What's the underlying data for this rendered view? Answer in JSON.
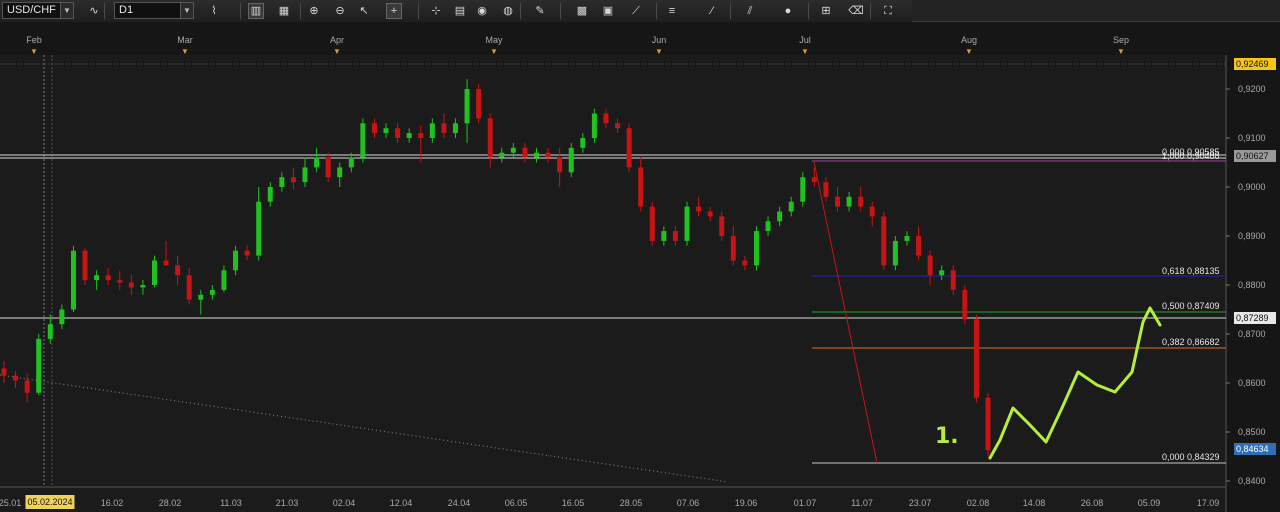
{
  "toolbar": {
    "symbol": "USD/CHF",
    "timeframe": "D1",
    "buttons": [
      {
        "name": "indicator-icon",
        "glyph": "∿"
      },
      {
        "name": "line-chart-icon",
        "glyph": "⌇"
      },
      {
        "name": "bar-chart-icon",
        "glyph": "▥"
      },
      {
        "name": "candle-chart-icon",
        "glyph": "▦"
      },
      {
        "name": "zoom-in-icon",
        "glyph": "⊕"
      },
      {
        "name": "zoom-out-icon",
        "glyph": "⊖"
      },
      {
        "name": "cursor-icon",
        "glyph": "↖"
      },
      {
        "name": "crosshair-icon",
        "glyph": "+"
      },
      {
        "name": "cursor-mode-icon",
        "glyph": "⊹"
      },
      {
        "name": "note-icon",
        "glyph": "▤"
      },
      {
        "name": "eye-icon",
        "glyph": "◉"
      },
      {
        "name": "globe-icon",
        "glyph": "◍"
      },
      {
        "name": "pencil-icon",
        "glyph": "✎"
      },
      {
        "name": "image-icon",
        "glyph": "▩"
      },
      {
        "name": "screenshot-icon",
        "glyph": "▣"
      },
      {
        "name": "fan-icon",
        "glyph": "⟋"
      },
      {
        "name": "fibonacci-icon",
        "glyph": "≡"
      },
      {
        "name": "line-tool-icon",
        "glyph": "∕"
      },
      {
        "name": "channel-icon",
        "glyph": "⫽"
      },
      {
        "name": "shape-icon",
        "glyph": "●"
      },
      {
        "name": "template-icon",
        "glyph": "⊞"
      },
      {
        "name": "eraser-icon",
        "glyph": "⌫"
      },
      {
        "name": "objects-icon",
        "glyph": "⛶"
      }
    ]
  },
  "months": [
    "Feb",
    "Mar",
    "Apr",
    "May",
    "Jun",
    "Jul",
    "Aug",
    "Sep"
  ],
  "dates": [
    "25.01",
    "16.02",
    "28.02",
    "11.03",
    "21.03",
    "02.04",
    "12.04",
    "24.04",
    "06.05",
    "16.05",
    "28.05",
    "07.06",
    "19.06",
    "01.07",
    "11.07",
    "23.07",
    "02.08",
    "14.08",
    "26.08",
    "05.09",
    "17.09"
  ],
  "highlighted_date": "05.02.2024",
  "price_axis": [
    "0,9200",
    "0,9100",
    "0,9000",
    "0,8900",
    "0,8800",
    "0,8700",
    "0,8600",
    "0,8500",
    "0,8400"
  ],
  "price_boxes": {
    "top": "0,92469",
    "current": "0,90627",
    "level": "0,87289",
    "bottom": "0,84634"
  },
  "fib_labels": [
    "0,000 0,90585",
    "1,000 0,90488",
    "0,618 0,88135",
    "0,500 0,87409",
    "0,382 0,86682",
    "0,000 0,84329"
  ],
  "handwritten_annotation": "1.",
  "colors": {
    "bull": "#1fc21f",
    "bear": "#c81414",
    "fib_blue": "#2020c0",
    "fib_green": "#20a020",
    "fib_orange": "#e07020",
    "fib_purple": "#a040a0",
    "annotation": "#b5ee3b"
  },
  "chart_data": {
    "type": "candlestick",
    "y_range": [
      0.84,
      0.926
    ],
    "levels": {
      "horizontal": [
        0.9062,
        0.8729
      ],
      "fib_0618": 0.88135,
      "fib_0500": 0.87409,
      "fib_0382": 0.86682,
      "fib_low": 0.84329,
      "fib_high": 0.90488
    },
    "series": [
      {
        "date": "29.01",
        "open": 0.863,
        "high": 0.8645,
        "low": 0.86,
        "close": 0.8615
      },
      {
        "date": "31.01",
        "open": 0.8615,
        "high": 0.8625,
        "low": 0.859,
        "close": 0.8605
      },
      {
        "date": "02.02",
        "open": 0.8605,
        "high": 0.862,
        "low": 0.856,
        "close": 0.858
      },
      {
        "date": "05.02",
        "open": 0.858,
        "high": 0.87,
        "low": 0.8575,
        "close": 0.869
      },
      {
        "date": "07.02",
        "open": 0.869,
        "high": 0.874,
        "low": 0.868,
        "close": 0.872
      },
      {
        "date": "09.02",
        "open": 0.872,
        "high": 0.876,
        "low": 0.871,
        "close": 0.875
      },
      {
        "date": "12.02",
        "open": 0.875,
        "high": 0.888,
        "low": 0.8745,
        "close": 0.887
      },
      {
        "date": "14.02",
        "open": 0.887,
        "high": 0.8875,
        "low": 0.88,
        "close": 0.881
      },
      {
        "date": "16.02",
        "open": 0.881,
        "high": 0.883,
        "low": 0.879,
        "close": 0.882
      },
      {
        "date": "19.02",
        "open": 0.882,
        "high": 0.8835,
        "low": 0.88,
        "close": 0.881
      },
      {
        "date": "21.02",
        "open": 0.881,
        "high": 0.883,
        "low": 0.879,
        "close": 0.8805
      },
      {
        "date": "23.02",
        "open": 0.8805,
        "high": 0.882,
        "low": 0.878,
        "close": 0.8795
      },
      {
        "date": "26.02",
        "open": 0.8795,
        "high": 0.881,
        "low": 0.878,
        "close": 0.88
      },
      {
        "date": "28.02",
        "open": 0.88,
        "high": 0.886,
        "low": 0.8795,
        "close": 0.885
      },
      {
        "date": "01.03",
        "open": 0.885,
        "high": 0.889,
        "low": 0.884,
        "close": 0.884
      },
      {
        "date": "04.03",
        "open": 0.884,
        "high": 0.886,
        "low": 0.88,
        "close": 0.882
      },
      {
        "date": "06.03",
        "open": 0.882,
        "high": 0.8835,
        "low": 0.876,
        "close": 0.877
      },
      {
        "date": "08.03",
        "open": 0.877,
        "high": 0.879,
        "low": 0.874,
        "close": 0.878
      },
      {
        "date": "11.03",
        "open": 0.878,
        "high": 0.88,
        "low": 0.877,
        "close": 0.879
      },
      {
        "date": "13.03",
        "open": 0.879,
        "high": 0.884,
        "low": 0.8785,
        "close": 0.883
      },
      {
        "date": "15.03",
        "open": 0.883,
        "high": 0.888,
        "low": 0.882,
        "close": 0.887
      },
      {
        "date": "18.03",
        "open": 0.887,
        "high": 0.888,
        "low": 0.885,
        "close": 0.886
      },
      {
        "date": "20.03",
        "open": 0.886,
        "high": 0.9,
        "low": 0.885,
        "close": 0.897
      },
      {
        "date": "22.03",
        "open": 0.897,
        "high": 0.901,
        "low": 0.896,
        "close": 0.9
      },
      {
        "date": "25.03",
        "open": 0.9,
        "high": 0.903,
        "low": 0.899,
        "close": 0.902
      },
      {
        "date": "27.03",
        "open": 0.902,
        "high": 0.904,
        "low": 0.8995,
        "close": 0.901
      },
      {
        "date": "29.03",
        "open": 0.901,
        "high": 0.906,
        "low": 0.9,
        "close": 0.904
      },
      {
        "date": "01.04",
        "open": 0.904,
        "high": 0.908,
        "low": 0.903,
        "close": 0.906
      },
      {
        "date": "03.04",
        "open": 0.906,
        "high": 0.907,
        "low": 0.901,
        "close": 0.902
      },
      {
        "date": "05.04",
        "open": 0.902,
        "high": 0.905,
        "low": 0.9,
        "close": 0.904
      },
      {
        "date": "08.04",
        "open": 0.904,
        "high": 0.907,
        "low": 0.903,
        "close": 0.906
      },
      {
        "date": "10.04",
        "open": 0.906,
        "high": 0.914,
        "low": 0.905,
        "close": 0.913
      },
      {
        "date": "12.04",
        "open": 0.913,
        "high": 0.914,
        "low": 0.91,
        "close": 0.911
      },
      {
        "date": "15.04",
        "open": 0.911,
        "high": 0.913,
        "low": 0.91,
        "close": 0.912
      },
      {
        "date": "17.04",
        "open": 0.912,
        "high": 0.913,
        "low": 0.909,
        "close": 0.91
      },
      {
        "date": "19.04",
        "open": 0.91,
        "high": 0.912,
        "low": 0.909,
        "close": 0.911
      },
      {
        "date": "22.04",
        "open": 0.911,
        "high": 0.9125,
        "low": 0.905,
        "close": 0.91
      },
      {
        "date": "24.04",
        "open": 0.91,
        "high": 0.914,
        "low": 0.909,
        "close": 0.913
      },
      {
        "date": "26.04",
        "open": 0.913,
        "high": 0.915,
        "low": 0.91,
        "close": 0.911
      },
      {
        "date": "29.04",
        "open": 0.911,
        "high": 0.914,
        "low": 0.91,
        "close": 0.913
      },
      {
        "date": "01.05",
        "open": 0.913,
        "high": 0.922,
        "low": 0.909,
        "close": 0.92
      },
      {
        "date": "03.05",
        "open": 0.92,
        "high": 0.921,
        "low": 0.913,
        "close": 0.914
      },
      {
        "date": "06.05",
        "open": 0.914,
        "high": 0.915,
        "low": 0.904,
        "close": 0.906
      },
      {
        "date": "08.05",
        "open": 0.906,
        "high": 0.908,
        "low": 0.905,
        "close": 0.907
      },
      {
        "date": "10.05",
        "open": 0.907,
        "high": 0.909,
        "low": 0.906,
        "close": 0.908
      },
      {
        "date": "13.05",
        "open": 0.908,
        "high": 0.909,
        "low": 0.905,
        "close": 0.906
      },
      {
        "date": "15.05",
        "open": 0.906,
        "high": 0.908,
        "low": 0.905,
        "close": 0.907
      },
      {
        "date": "17.05",
        "open": 0.907,
        "high": 0.908,
        "low": 0.905,
        "close": 0.906
      },
      {
        "date": "20.05",
        "open": 0.906,
        "high": 0.908,
        "low": 0.9,
        "close": 0.903
      },
      {
        "date": "22.05",
        "open": 0.903,
        "high": 0.909,
        "low": 0.902,
        "close": 0.908
      },
      {
        "date": "24.05",
        "open": 0.908,
        "high": 0.911,
        "low": 0.907,
        "close": 0.91
      },
      {
        "date": "27.05",
        "open": 0.91,
        "high": 0.916,
        "low": 0.909,
        "close": 0.915
      },
      {
        "date": "29.05",
        "open": 0.915,
        "high": 0.916,
        "low": 0.912,
        "close": 0.913
      },
      {
        "date": "31.05",
        "open": 0.913,
        "high": 0.914,
        "low": 0.911,
        "close": 0.912
      },
      {
        "date": "03.06",
        "open": 0.912,
        "high": 0.913,
        "low": 0.903,
        "close": 0.904
      },
      {
        "date": "05.06",
        "open": 0.904,
        "high": 0.906,
        "low": 0.895,
        "close": 0.896
      },
      {
        "date": "07.06",
        "open": 0.896,
        "high": 0.897,
        "low": 0.888,
        "close": 0.889
      },
      {
        "date": "10.06",
        "open": 0.889,
        "high": 0.892,
        "low": 0.888,
        "close": 0.891
      },
      {
        "date": "12.06",
        "open": 0.891,
        "high": 0.892,
        "low": 0.888,
        "close": 0.889
      },
      {
        "date": "14.06",
        "open": 0.889,
        "high": 0.897,
        "low": 0.888,
        "close": 0.896
      },
      {
        "date": "17.06",
        "open": 0.896,
        "high": 0.898,
        "low": 0.894,
        "close": 0.895
      },
      {
        "date": "19.06",
        "open": 0.895,
        "high": 0.896,
        "low": 0.893,
        "close": 0.894
      },
      {
        "date": "21.06",
        "open": 0.894,
        "high": 0.895,
        "low": 0.889,
        "close": 0.89
      },
      {
        "date": "24.06",
        "open": 0.89,
        "high": 0.892,
        "low": 0.884,
        "close": 0.885
      },
      {
        "date": "26.06",
        "open": 0.885,
        "high": 0.886,
        "low": 0.883,
        "close": 0.884
      },
      {
        "date": "28.06",
        "open": 0.884,
        "high": 0.892,
        "low": 0.883,
        "close": 0.891
      },
      {
        "date": "01.07",
        "open": 0.891,
        "high": 0.894,
        "low": 0.89,
        "close": 0.893
      },
      {
        "date": "03.07",
        "open": 0.893,
        "high": 0.896,
        "low": 0.892,
        "close": 0.895
      },
      {
        "date": "05.07",
        "open": 0.895,
        "high": 0.898,
        "low": 0.894,
        "close": 0.897
      },
      {
        "date": "08.07",
        "open": 0.897,
        "high": 0.903,
        "low": 0.896,
        "close": 0.902
      },
      {
        "date": "10.07",
        "open": 0.902,
        "high": 0.904,
        "low": 0.9,
        "close": 0.901
      },
      {
        "date": "12.07",
        "open": 0.901,
        "high": 0.902,
        "low": 0.897,
        "close": 0.898
      },
      {
        "date": "15.07",
        "open": 0.898,
        "high": 0.9,
        "low": 0.895,
        "close": 0.896
      },
      {
        "date": "17.07",
        "open": 0.896,
        "high": 0.899,
        "low": 0.895,
        "close": 0.898
      },
      {
        "date": "19.07",
        "open": 0.898,
        "high": 0.9,
        "low": 0.895,
        "close": 0.896
      },
      {
        "date": "22.07",
        "open": 0.896,
        "high": 0.897,
        "low": 0.892,
        "close": 0.894
      },
      {
        "date": "24.07",
        "open": 0.894,
        "high": 0.895,
        "low": 0.883,
        "close": 0.884
      },
      {
        "date": "26.07",
        "open": 0.884,
        "high": 0.89,
        "low": 0.883,
        "close": 0.889
      },
      {
        "date": "29.07",
        "open": 0.889,
        "high": 0.891,
        "low": 0.888,
        "close": 0.89
      },
      {
        "date": "31.07",
        "open": 0.89,
        "high": 0.892,
        "low": 0.885,
        "close": 0.886
      },
      {
        "date": "02.08",
        "open": 0.886,
        "high": 0.887,
        "low": 0.88,
        "close": 0.882
      },
      {
        "date": "05.08",
        "open": 0.882,
        "high": 0.884,
        "low": 0.881,
        "close": 0.883
      },
      {
        "date": "07.08",
        "open": 0.883,
        "high": 0.884,
        "low": 0.878,
        "close": 0.879
      },
      {
        "date": "09.08",
        "open": 0.879,
        "high": 0.88,
        "low": 0.872,
        "close": 0.873
      },
      {
        "date": "12.08",
        "open": 0.873,
        "high": 0.874,
        "low": 0.856,
        "close": 0.857
      },
      {
        "date": "14.08",
        "open": 0.857,
        "high": 0.858,
        "low": 0.845,
        "close": 0.8463
      }
    ]
  }
}
